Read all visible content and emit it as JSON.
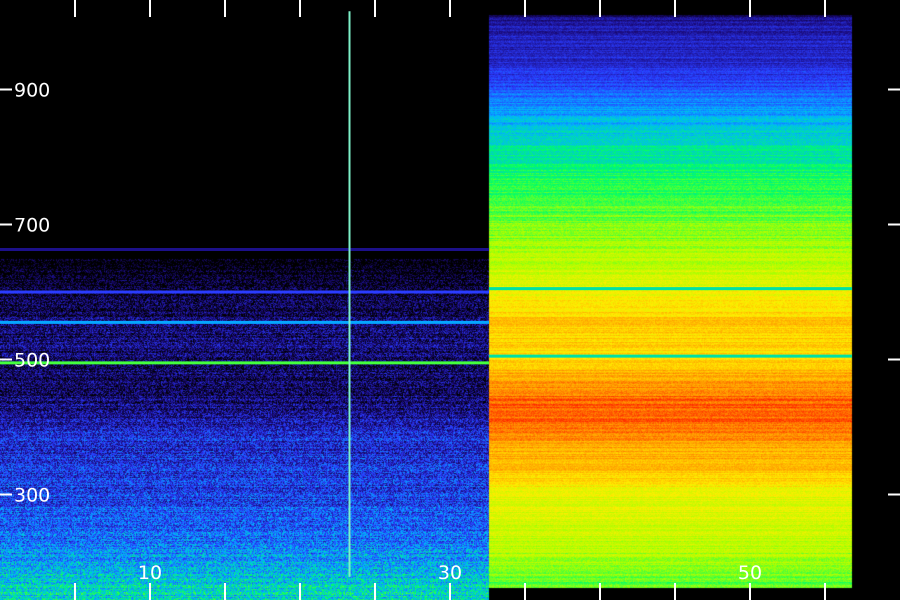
{
  "chart_data": {
    "type": "heatmap",
    "title": "",
    "xlabel": "",
    "ylabel": "",
    "x_tick_labels": [
      {
        "value": 10,
        "label": "10"
      },
      {
        "value": 30,
        "label": "30"
      },
      {
        "value": 50,
        "label": "50"
      }
    ],
    "y_tick_labels": [
      {
        "value": 300,
        "label": "300"
      },
      {
        "value": 500,
        "label": "500"
      },
      {
        "value": 700,
        "label": "700"
      },
      {
        "value": 900,
        "label": "900"
      }
    ],
    "x_minor_ticks": [
      0,
      5,
      10,
      15,
      20,
      25,
      30,
      35,
      40,
      45,
      50,
      55
    ],
    "y_minor_ticks": [
      300,
      500,
      700,
      900
    ],
    "xlim": [
      0,
      58
    ],
    "ylim": [
      162,
      1046
    ],
    "colormap": [
      "#000000",
      "#1a0a7a",
      "#2a3cff",
      "#00b4ff",
      "#00ff66",
      "#aaff00",
      "#ffee00",
      "#ff9900",
      "#ff1a00"
    ],
    "grid": false,
    "regions": [
      {
        "name": "low-activity",
        "x_range": [
          0,
          32.6
        ],
        "profile": [
          {
            "y": 162,
            "level": 0.42
          },
          {
            "y": 190,
            "level": 0.38
          },
          {
            "y": 230,
            "level": 0.3
          },
          {
            "y": 270,
            "level": 0.27
          },
          {
            "y": 310,
            "level": 0.24
          },
          {
            "y": 350,
            "level": 0.22
          },
          {
            "y": 390,
            "level": 0.2
          },
          {
            "y": 430,
            "level": 0.12
          },
          {
            "y": 470,
            "level": 0.1
          },
          {
            "y": 530,
            "level": 0.12
          },
          {
            "y": 570,
            "level": 0.09
          },
          {
            "y": 610,
            "level": 0.05
          },
          {
            "y": 650,
            "level": 0.0
          },
          {
            "y": 1046,
            "level": 0.0
          }
        ],
        "lines": [
          {
            "y": 495,
            "level": 0.55
          },
          {
            "y": 555,
            "level": 0.36
          },
          {
            "y": 600,
            "level": 0.25
          },
          {
            "y": 663,
            "level": 0.14
          }
        ]
      },
      {
        "name": "high-activity",
        "x_range": [
          32.6,
          56.8
        ],
        "y_range": [
          162,
          1011
        ],
        "profile": [
          {
            "y": 162,
            "level": 0.55
          },
          {
            "y": 200,
            "level": 0.62
          },
          {
            "y": 250,
            "level": 0.68
          },
          {
            "y": 300,
            "level": 0.72
          },
          {
            "y": 340,
            "level": 0.82
          },
          {
            "y": 380,
            "level": 0.86
          },
          {
            "y": 410,
            "level": 0.93
          },
          {
            "y": 440,
            "level": 0.93
          },
          {
            "y": 480,
            "level": 0.84
          },
          {
            "y": 510,
            "level": 0.78
          },
          {
            "y": 560,
            "level": 0.8
          },
          {
            "y": 600,
            "level": 0.72
          },
          {
            "y": 640,
            "level": 0.66
          },
          {
            "y": 700,
            "level": 0.58
          },
          {
            "y": 760,
            "level": 0.52
          },
          {
            "y": 820,
            "level": 0.44
          },
          {
            "y": 870,
            "level": 0.35
          },
          {
            "y": 910,
            "level": 0.25
          },
          {
            "y": 950,
            "level": 0.2
          },
          {
            "y": 1000,
            "level": 0.16
          },
          {
            "y": 1011,
            "level": 0.1
          }
        ],
        "lines": [
          {
            "y": 505,
            "level": 0.45
          },
          {
            "y": 605,
            "level": 0.45
          }
        ]
      }
    ],
    "spikes": [
      {
        "x": 23.3,
        "y_range": [
          178,
          1016
        ]
      }
    ]
  }
}
